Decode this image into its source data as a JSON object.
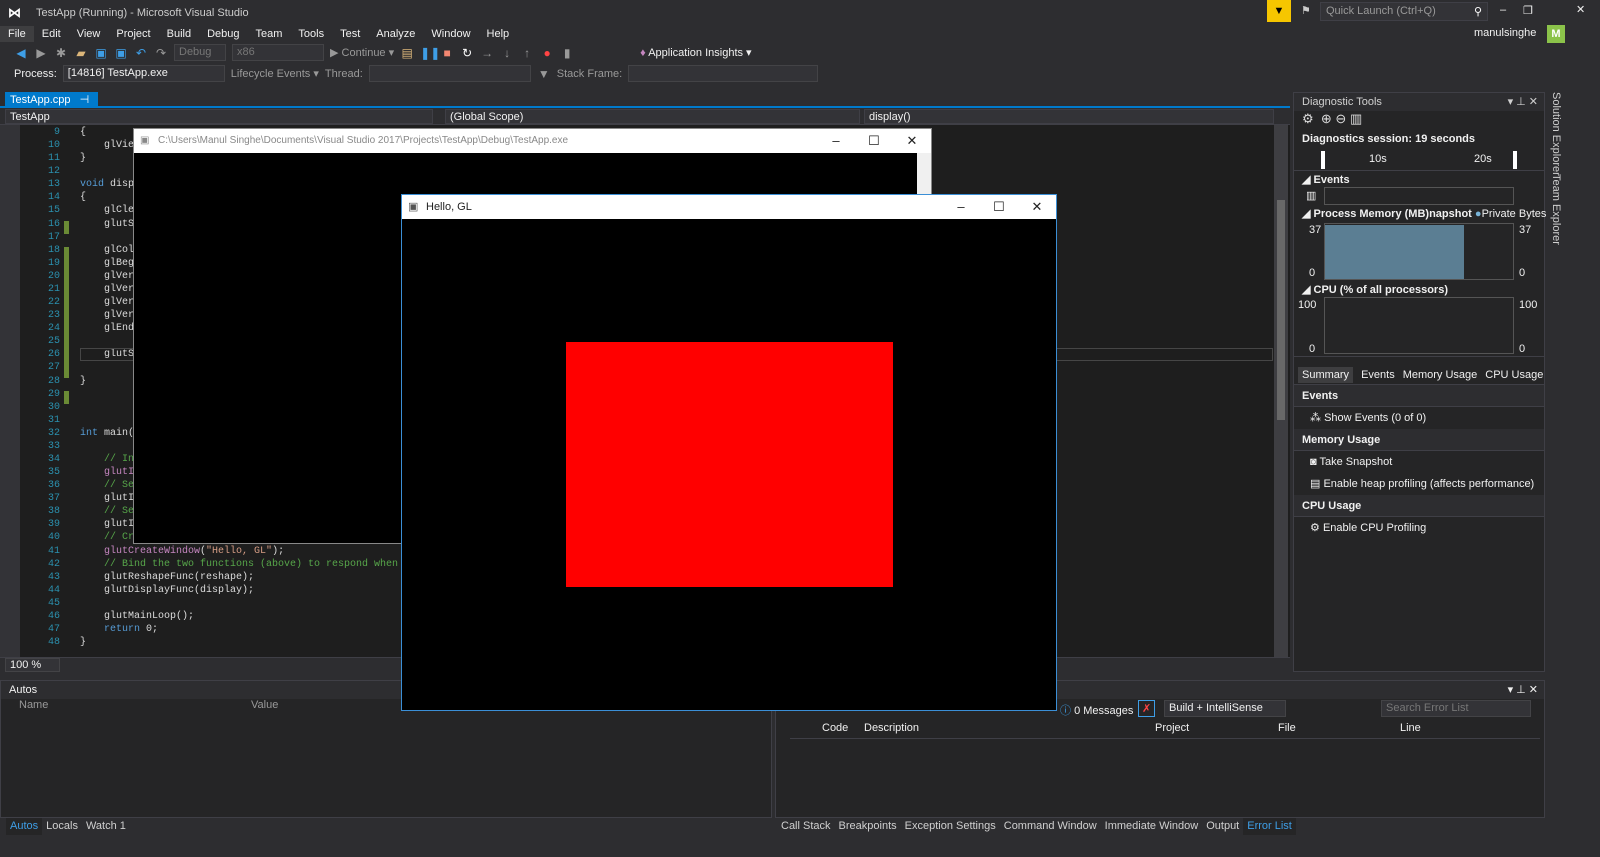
{
  "window": {
    "title": "TestApp (Running) - Microsoft Visual Studio",
    "quick_launch": "Quick Launch (Ctrl+Q)",
    "user": "manulsinghe",
    "avatar": "M"
  },
  "menu": [
    "File",
    "Edit",
    "View",
    "Project",
    "Build",
    "Debug",
    "Team",
    "Tools",
    "Test",
    "Analyze",
    "Window",
    "Help"
  ],
  "toolbar": {
    "config": "Debug",
    "platform": "x86",
    "continue": "Continue",
    "app_insights": "Application Insights"
  },
  "toolbar2": {
    "process_label": "Process:",
    "process": "[14816] TestApp.exe",
    "lifecycle": "Lifecycle Events",
    "thread_label": "Thread:",
    "stack_label": "Stack Frame:"
  },
  "doc_tab": "TestApp.cpp",
  "nav": {
    "project": "TestApp",
    "scope": "(Global Scope)",
    "member": "display()"
  },
  "code": [
    {
      "n": "9",
      "s": [
        [
          "tx",
          "{"
        ]
      ]
    },
    {
      "n": "10",
      "s": [
        [
          "tx",
          "    glVie"
        ]
      ]
    },
    {
      "n": "11",
      "s": [
        [
          "tx",
          "}"
        ]
      ]
    },
    {
      "n": "12",
      "s": []
    },
    {
      "n": "13",
      "s": [
        [
          "kw",
          "void"
        ],
        [
          "tx",
          " displ"
        ]
      ]
    },
    {
      "n": "14",
      "s": [
        [
          "tx",
          "{"
        ]
      ]
    },
    {
      "n": "15",
      "s": [
        [
          "tx",
          "    glClea"
        ]
      ]
    },
    {
      "n": "16",
      "s": [
        [
          "tx",
          "    glutSw"
        ]
      ]
    },
    {
      "n": "17",
      "s": []
    },
    {
      "n": "18",
      "s": [
        [
          "tx",
          "    glColo"
        ]
      ]
    },
    {
      "n": "19",
      "s": [
        [
          "tx",
          "    glBegi"
        ]
      ]
    },
    {
      "n": "20",
      "s": [
        [
          "tx",
          "    glVert"
        ]
      ]
    },
    {
      "n": "21",
      "s": [
        [
          "tx",
          "    glVert"
        ]
      ]
    },
    {
      "n": "22",
      "s": [
        [
          "tx",
          "    glVert"
        ]
      ]
    },
    {
      "n": "23",
      "s": [
        [
          "tx",
          "    glVert"
        ]
      ]
    },
    {
      "n": "24",
      "s": [
        [
          "tx",
          "    glEnd("
        ]
      ]
    },
    {
      "n": "25",
      "s": []
    },
    {
      "n": "26",
      "s": [
        [
          "tx",
          "    glutSw"
        ]
      ]
    },
    {
      "n": "27",
      "s": []
    },
    {
      "n": "28",
      "s": [
        [
          "tx",
          "}"
        ]
      ]
    },
    {
      "n": "29",
      "s": []
    },
    {
      "n": "30",
      "s": []
    },
    {
      "n": "31",
      "s": []
    },
    {
      "n": "32",
      "s": [
        [
          "kw",
          "int"
        ],
        [
          "tx",
          " main(i"
        ]
      ]
    },
    {
      "n": "33",
      "s": []
    },
    {
      "n": "34",
      "s": [
        [
          "cm",
          "    // Ini"
        ]
      ]
    },
    {
      "n": "35",
      "s": [
        [
          "fn",
          "    glutIn"
        ]
      ]
    },
    {
      "n": "36",
      "s": [
        [
          "cm",
          "    // Set"
        ]
      ]
    },
    {
      "n": "37",
      "s": [
        [
          "tx",
          "    glutIn"
        ]
      ]
    },
    {
      "n": "38",
      "s": [
        [
          "cm",
          "    // Set"
        ]
      ]
    },
    {
      "n": "39",
      "s": [
        [
          "tx",
          "    glutIn"
        ]
      ]
    },
    {
      "n": "40",
      "s": [
        [
          "cm",
          "    // Cre"
        ]
      ]
    },
    {
      "n": "41",
      "s": [
        [
          "fn",
          "    glutCreateWindow"
        ],
        [
          "tx",
          "("
        ],
        [
          "st",
          "\"Hello, GL\""
        ],
        [
          "tx",
          ");"
        ]
      ]
    },
    {
      "n": "42",
      "s": [
        [
          "cm",
          "    // Bind the two functions (above) to respond when ne"
        ]
      ]
    },
    {
      "n": "43",
      "s": [
        [
          "tx",
          "    glutReshapeFunc(reshape);"
        ]
      ]
    },
    {
      "n": "44",
      "s": [
        [
          "tx",
          "    glutDisplayFunc(display);"
        ]
      ]
    },
    {
      "n": "45",
      "s": []
    },
    {
      "n": "46",
      "s": [
        [
          "tx",
          "    glutMainLoop();"
        ]
      ]
    },
    {
      "n": "47",
      "s": [
        [
          "kw",
          "    return"
        ],
        [
          "tx",
          " 0;"
        ]
      ]
    },
    {
      "n": "48",
      "s": [
        [
          "tx",
          "}"
        ]
      ]
    }
  ],
  "zoom": "100 %",
  "console_window": {
    "title": "C:\\Users\\Manul Singhe\\Documents\\Visual Studio 2017\\Projects\\TestApp\\Debug\\TestApp.exe"
  },
  "gl_window": {
    "title": "Hello, GL",
    "fill_color": "#ff0000"
  },
  "diagnostics": {
    "title": "Diagnostic Tools",
    "session": "Diagnostics session: 19 seconds",
    "t10": "10s",
    "t20": "20s",
    "events": "Events",
    "memory_title": "Process Memory (MB)",
    "snapshot_fragment": "napshot",
    "private_bytes": "Private Bytes",
    "mem_max": "37",
    "mem_min": "0",
    "cpu_title": "CPU (% of all processors)",
    "cpu_max": "100",
    "cpu_min": "0",
    "memory_value_mb": 37,
    "tabs": [
      "Summary",
      "Events",
      "Memory Usage",
      "CPU Usage"
    ],
    "sec_events": "Events",
    "show_events": "Show Events (0 of 0)",
    "sec_memory": "Memory Usage",
    "take_snapshot": "Take Snapshot",
    "heap": "Enable heap profiling (affects performance)",
    "sec_cpu": "CPU Usage",
    "cpu_profiling": "Enable CPU Profiling"
  },
  "side_tabs": [
    "Solution Explorer",
    "Team Explorer"
  ],
  "autos": {
    "title": "Autos",
    "cols": [
      "Name",
      "Value"
    ],
    "tabs": [
      "Autos",
      "Locals",
      "Watch 1"
    ]
  },
  "errors": {
    "messages": "0 Messages",
    "filter": "Build + IntelliSense",
    "search": "Search Error List",
    "cols": [
      "Code",
      "Description",
      "Project",
      "File",
      "Line"
    ],
    "tabs": [
      "Call Stack",
      "Breakpoints",
      "Exception Settings",
      "Command Window",
      "Immediate Window",
      "Output",
      "Error List"
    ]
  }
}
